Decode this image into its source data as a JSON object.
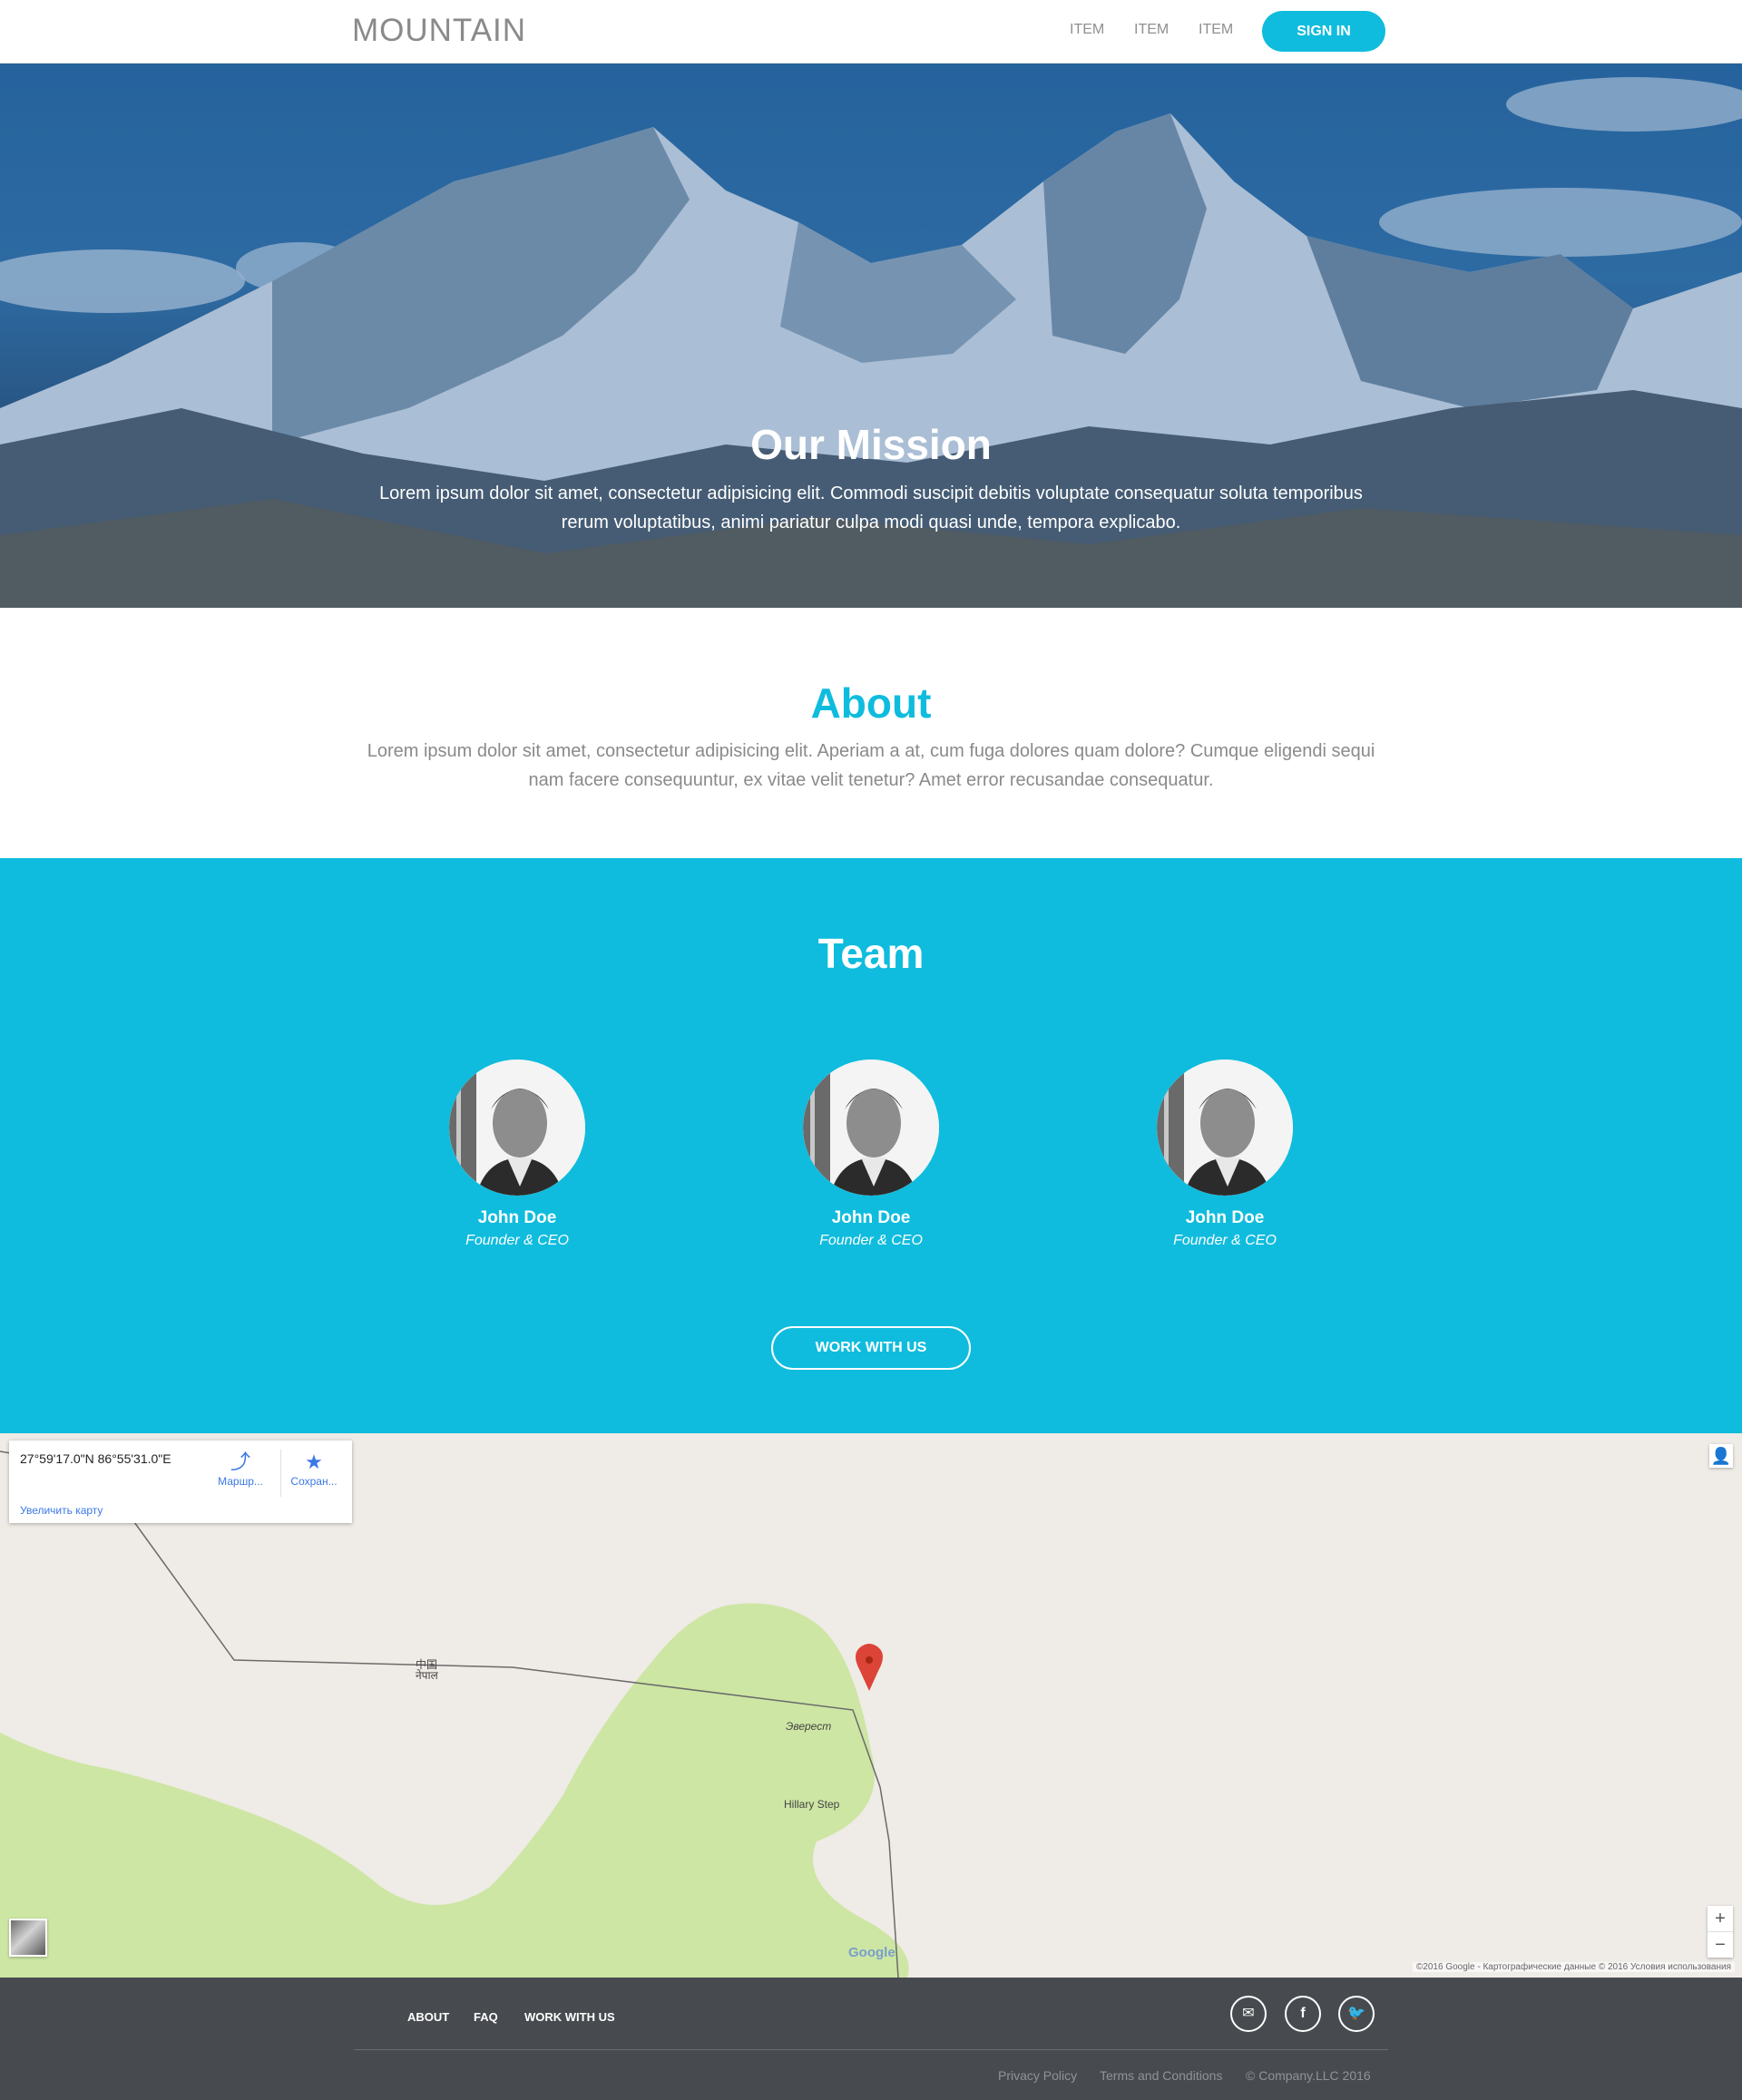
{
  "header": {
    "logo": "MOUNTAIN",
    "nav": [
      "ITEM",
      "ITEM",
      "ITEM"
    ],
    "signin": "SIGN IN"
  },
  "hero": {
    "title": "Our Mission",
    "text": "Lorem ipsum dolor sit amet, consectetur adipisicing elit. Commodi suscipit debitis voluptate consequatur soluta temporibus rerum voluptatibus, animi pariatur culpa modi quasi unde, tempora explicabo."
  },
  "about": {
    "title": "About",
    "text": "Lorem ipsum dolor sit amet, consectetur adipisicing elit. Aperiam a at, cum fuga dolores quam dolore? Cumque eligendi sequi nam facere consequuntur, ex vitae velit tenetur? Amet error recusandae consequatur."
  },
  "team": {
    "title": "Team",
    "members": [
      {
        "name": "John Doe",
        "role": "Founder & CEO"
      },
      {
        "name": "John Doe",
        "role": "Founder & CEO"
      },
      {
        "name": "John Doe",
        "role": "Founder & CEO"
      }
    ],
    "cta": "WORK WITH US"
  },
  "map": {
    "coords": "27°59'17.0\"N 86°55'31.0\"E",
    "route_label": "Маршр...",
    "save_label": "Сохран...",
    "enlarge": "Увеличить карту",
    "label_everest": "Эверест",
    "label_hillary": "Hillary Step",
    "label_china": "中国",
    "label_nepal": "नेपाल",
    "google": "Google",
    "credit": "©2016 Google - Картографические данные © 2016     Условия использования",
    "zoom_in": "+",
    "zoom_out": "−"
  },
  "footer": {
    "links": [
      "ABOUT",
      "FAQ",
      "WORK WITH US"
    ],
    "social": [
      "envelope-icon",
      "facebook-icon",
      "twitter-icon"
    ],
    "privacy": "Privacy Policy",
    "terms": "Terms and Conditions",
    "copyright": "© Company.LLC 2016"
  }
}
